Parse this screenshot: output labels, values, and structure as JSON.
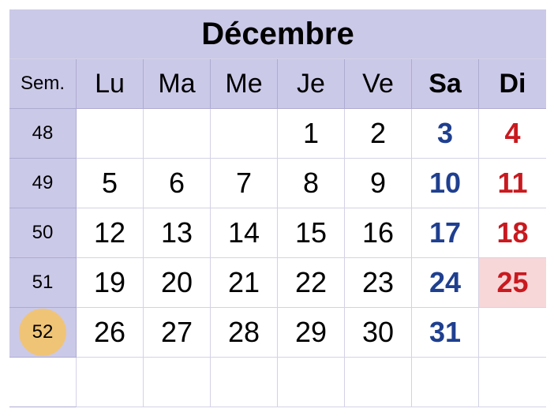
{
  "title": "Décembre",
  "headers": {
    "week": "Sem.",
    "days": [
      "Lu",
      "Ma",
      "Me",
      "Je",
      "Ve",
      "Sa",
      "Di"
    ]
  },
  "weeks": [
    {
      "num": "48",
      "days": [
        "",
        "",
        "",
        "1",
        "2",
        "3",
        "4"
      ]
    },
    {
      "num": "49",
      "days": [
        "5",
        "6",
        "7",
        "8",
        "9",
        "10",
        "11"
      ]
    },
    {
      "num": "50",
      "days": [
        "12",
        "13",
        "14",
        "15",
        "16",
        "17",
        "18"
      ]
    },
    {
      "num": "51",
      "days": [
        "19",
        "20",
        "21",
        "22",
        "23",
        "24",
        "25"
      ]
    },
    {
      "num": "52",
      "days": [
        "26",
        "27",
        "28",
        "29",
        "30",
        "31",
        ""
      ]
    },
    {
      "num": "",
      "days": [
        "",
        "",
        "",
        "",
        "",
        "",
        ""
      ]
    }
  ],
  "current_week": "52",
  "highlighted_day": "25",
  "colors": {
    "header_bg": "#cbc9e8",
    "saturday": "#1f3f8f",
    "sunday": "#c81a1f",
    "holiday_bg": "#f8d7d9",
    "current_week_marker": "#efc477"
  }
}
